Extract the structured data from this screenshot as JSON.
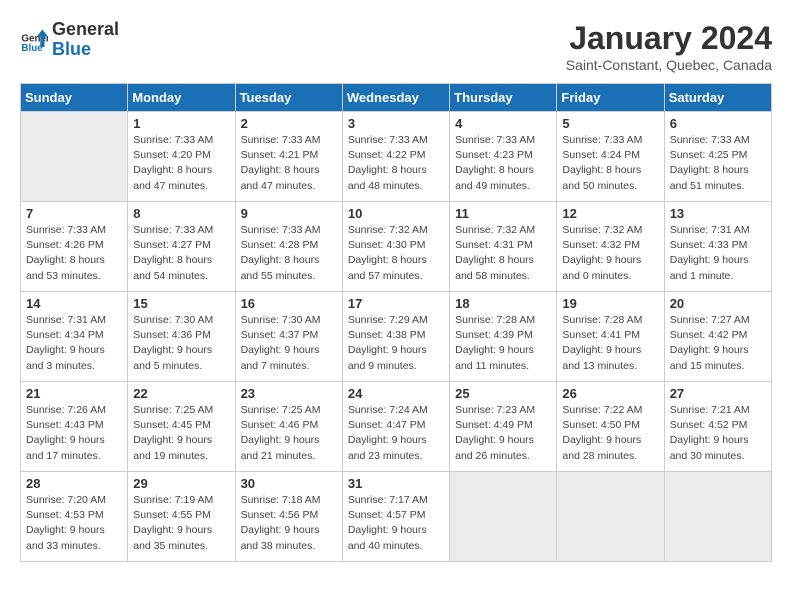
{
  "header": {
    "logo_text_general": "General",
    "logo_text_blue": "Blue",
    "month": "January 2024",
    "location": "Saint-Constant, Quebec, Canada"
  },
  "days_of_week": [
    "Sunday",
    "Monday",
    "Tuesday",
    "Wednesday",
    "Thursday",
    "Friday",
    "Saturday"
  ],
  "weeks": [
    [
      {
        "day": null
      },
      {
        "day": "1",
        "sunrise": "7:33 AM",
        "sunset": "4:20 PM",
        "daylight": "8 hours and 47 minutes."
      },
      {
        "day": "2",
        "sunrise": "7:33 AM",
        "sunset": "4:21 PM",
        "daylight": "8 hours and 47 minutes."
      },
      {
        "day": "3",
        "sunrise": "7:33 AM",
        "sunset": "4:22 PM",
        "daylight": "8 hours and 48 minutes."
      },
      {
        "day": "4",
        "sunrise": "7:33 AM",
        "sunset": "4:23 PM",
        "daylight": "8 hours and 49 minutes."
      },
      {
        "day": "5",
        "sunrise": "7:33 AM",
        "sunset": "4:24 PM",
        "daylight": "8 hours and 50 minutes."
      },
      {
        "day": "6",
        "sunrise": "7:33 AM",
        "sunset": "4:25 PM",
        "daylight": "8 hours and 51 minutes."
      }
    ],
    [
      {
        "day": "7",
        "sunrise": "7:33 AM",
        "sunset": "4:26 PM",
        "daylight": "8 hours and 53 minutes."
      },
      {
        "day": "8",
        "sunrise": "7:33 AM",
        "sunset": "4:27 PM",
        "daylight": "8 hours and 54 minutes."
      },
      {
        "day": "9",
        "sunrise": "7:33 AM",
        "sunset": "4:28 PM",
        "daylight": "8 hours and 55 minutes."
      },
      {
        "day": "10",
        "sunrise": "7:32 AM",
        "sunset": "4:30 PM",
        "daylight": "8 hours and 57 minutes."
      },
      {
        "day": "11",
        "sunrise": "7:32 AM",
        "sunset": "4:31 PM",
        "daylight": "8 hours and 58 minutes."
      },
      {
        "day": "12",
        "sunrise": "7:32 AM",
        "sunset": "4:32 PM",
        "daylight": "9 hours and 0 minutes."
      },
      {
        "day": "13",
        "sunrise": "7:31 AM",
        "sunset": "4:33 PM",
        "daylight": "9 hours and 1 minute."
      }
    ],
    [
      {
        "day": "14",
        "sunrise": "7:31 AM",
        "sunset": "4:34 PM",
        "daylight": "9 hours and 3 minutes."
      },
      {
        "day": "15",
        "sunrise": "7:30 AM",
        "sunset": "4:36 PM",
        "daylight": "9 hours and 5 minutes."
      },
      {
        "day": "16",
        "sunrise": "7:30 AM",
        "sunset": "4:37 PM",
        "daylight": "9 hours and 7 minutes."
      },
      {
        "day": "17",
        "sunrise": "7:29 AM",
        "sunset": "4:38 PM",
        "daylight": "9 hours and 9 minutes."
      },
      {
        "day": "18",
        "sunrise": "7:28 AM",
        "sunset": "4:39 PM",
        "daylight": "9 hours and 11 minutes."
      },
      {
        "day": "19",
        "sunrise": "7:28 AM",
        "sunset": "4:41 PM",
        "daylight": "9 hours and 13 minutes."
      },
      {
        "day": "20",
        "sunrise": "7:27 AM",
        "sunset": "4:42 PM",
        "daylight": "9 hours and 15 minutes."
      }
    ],
    [
      {
        "day": "21",
        "sunrise": "7:26 AM",
        "sunset": "4:43 PM",
        "daylight": "9 hours and 17 minutes."
      },
      {
        "day": "22",
        "sunrise": "7:25 AM",
        "sunset": "4:45 PM",
        "daylight": "9 hours and 19 minutes."
      },
      {
        "day": "23",
        "sunrise": "7:25 AM",
        "sunset": "4:46 PM",
        "daylight": "9 hours and 21 minutes."
      },
      {
        "day": "24",
        "sunrise": "7:24 AM",
        "sunset": "4:47 PM",
        "daylight": "9 hours and 23 minutes."
      },
      {
        "day": "25",
        "sunrise": "7:23 AM",
        "sunset": "4:49 PM",
        "daylight": "9 hours and 26 minutes."
      },
      {
        "day": "26",
        "sunrise": "7:22 AM",
        "sunset": "4:50 PM",
        "daylight": "9 hours and 28 minutes."
      },
      {
        "day": "27",
        "sunrise": "7:21 AM",
        "sunset": "4:52 PM",
        "daylight": "9 hours and 30 minutes."
      }
    ],
    [
      {
        "day": "28",
        "sunrise": "7:20 AM",
        "sunset": "4:53 PM",
        "daylight": "9 hours and 33 minutes."
      },
      {
        "day": "29",
        "sunrise": "7:19 AM",
        "sunset": "4:55 PM",
        "daylight": "9 hours and 35 minutes."
      },
      {
        "day": "30",
        "sunrise": "7:18 AM",
        "sunset": "4:56 PM",
        "daylight": "9 hours and 38 minutes."
      },
      {
        "day": "31",
        "sunrise": "7:17 AM",
        "sunset": "4:57 PM",
        "daylight": "9 hours and 40 minutes."
      },
      {
        "day": null
      },
      {
        "day": null
      },
      {
        "day": null
      }
    ]
  ]
}
